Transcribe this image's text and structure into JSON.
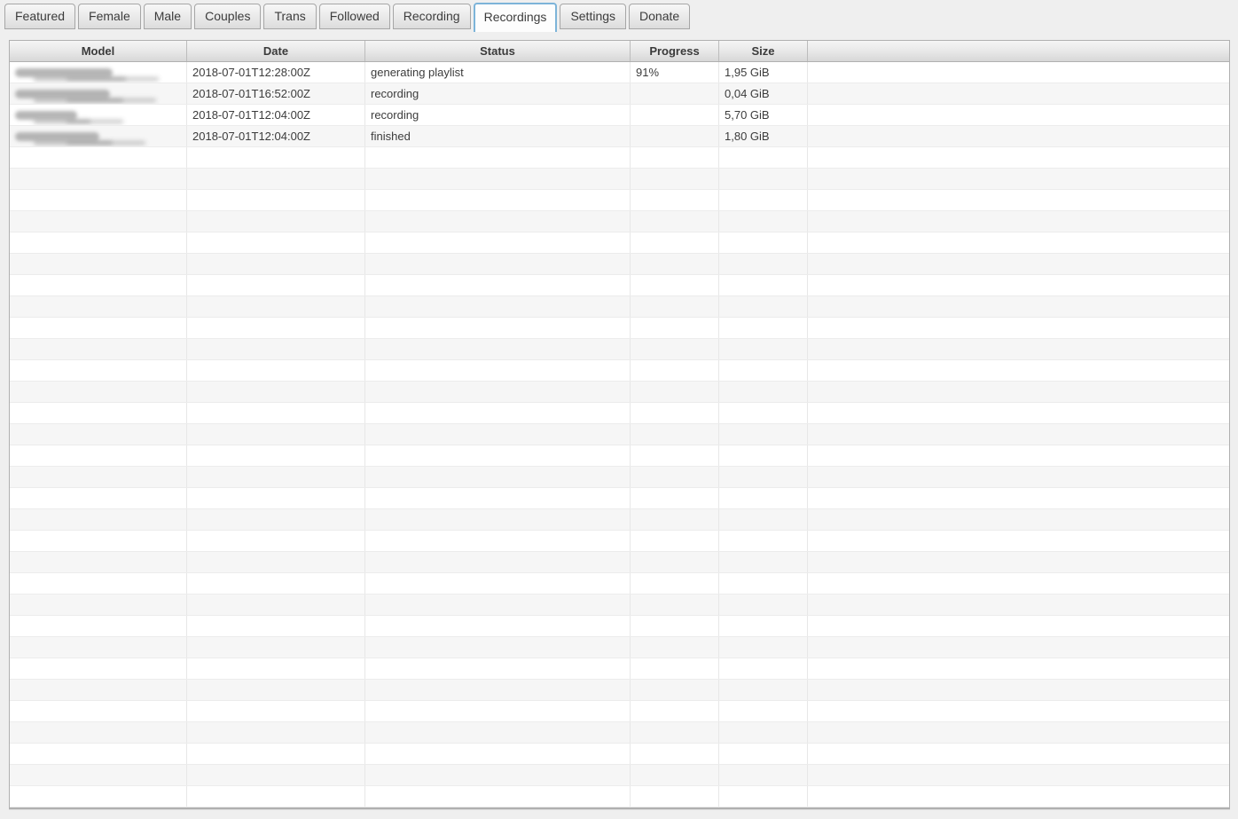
{
  "window": {
    "background": "#efefef"
  },
  "tabs": [
    {
      "label": "Featured",
      "active": false
    },
    {
      "label": "Female",
      "active": false
    },
    {
      "label": "Male",
      "active": false
    },
    {
      "label": "Couples",
      "active": false
    },
    {
      "label": "Trans",
      "active": false
    },
    {
      "label": "Followed",
      "active": false
    },
    {
      "label": "Recording",
      "active": false
    },
    {
      "label": "Recordings",
      "active": true
    },
    {
      "label": "Settings",
      "active": false
    },
    {
      "label": "Donate",
      "active": false
    }
  ],
  "table": {
    "columns": [
      {
        "label": "Model"
      },
      {
        "label": "Date"
      },
      {
        "label": "Status"
      },
      {
        "label": "Progress"
      },
      {
        "label": "Size"
      }
    ],
    "rows": [
      {
        "model": "",
        "model_blurred": true,
        "blur_width": 110,
        "date": "2018-07-01T12:28:00Z",
        "status": "generating playlist",
        "progress": "91%",
        "size": "1,95 GiB"
      },
      {
        "model": "",
        "model_blurred": true,
        "blur_width": 107,
        "date": "2018-07-01T16:52:00Z",
        "status": "recording",
        "progress": "",
        "size": "0,04 GiB"
      },
      {
        "model": "",
        "model_blurred": true,
        "blur_width": 70,
        "date": "2018-07-01T12:04:00Z",
        "status": "recording",
        "progress": "",
        "size": "5,70 GiB"
      },
      {
        "model": "",
        "model_blurred": true,
        "blur_width": 95,
        "date": "2018-07-01T12:04:00Z",
        "status": "finished",
        "progress": "",
        "size": "1,80 GiB"
      }
    ],
    "empty_row_count": 31
  },
  "colors": {
    "accent_tab_border": "#7db4d9",
    "header_text": "#3a3a3a",
    "cell_text": "#3c3c3c",
    "row_stripe": "#f6f6f6",
    "table_border": "#b0b0b0"
  }
}
